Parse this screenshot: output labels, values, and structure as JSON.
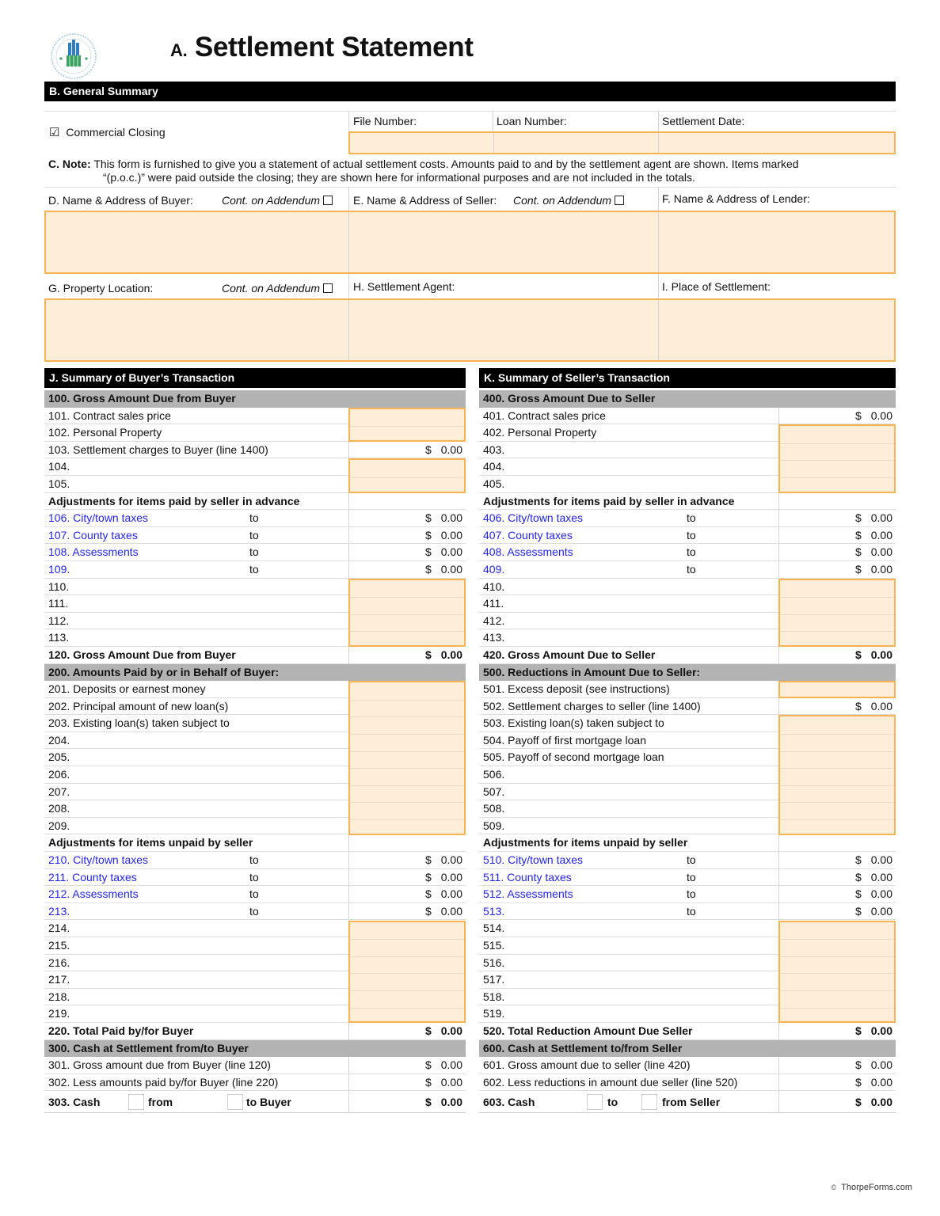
{
  "header": {
    "title_prefix": "A.",
    "title": "Settlement Statement",
    "seal_icon": "hud-seal-icon"
  },
  "general_summary": {
    "bar_label": "B. General Summary",
    "commercial_closing": {
      "label": "Commercial Closing",
      "checked": true,
      "glyph": "☑"
    },
    "file_number": {
      "label": "File Number:",
      "value": ""
    },
    "loan_number": {
      "label": "Loan Number:",
      "value": ""
    },
    "settlement_date": {
      "label": "Settlement Date:",
      "value": ""
    },
    "note_label": "C. Note:",
    "note_line1": "This form is furnished to give you a statement of actual settlement costs. Amounts paid to and by the settlement agent are shown. Items marked",
    "note_line2": "“(p.o.c.)” were paid outside the closing; they are shown here for informational purposes and are not included in the totals.",
    "buyer": {
      "label": "D. Name & Address of Buyer:",
      "addendum": "Cont. on Addendum",
      "value": ""
    },
    "seller": {
      "label": "E. Name & Address of Seller:",
      "addendum": "Cont. on Addendum",
      "value": ""
    },
    "lender": {
      "label": "F. Name & Address of Lender:",
      "value": ""
    },
    "property": {
      "label": "G. Property Location:",
      "addendum": "Cont. on Addendum",
      "value": ""
    },
    "agent": {
      "label": "H. Settlement Agent:",
      "value": ""
    },
    "place": {
      "label": "I. Place of Settlement:",
      "value": ""
    }
  },
  "buyer_summary": {
    "bar_label": "J. Summary of Buyer’s Transaction",
    "rows": [
      {
        "type": "gray",
        "text": "100. Gross Amount Due from Buyer"
      },
      {
        "type": "input",
        "text": "101. Contract sales price"
      },
      {
        "type": "input",
        "text": "102. Personal Property"
      },
      {
        "type": "calc",
        "text": "103. Settlement charges to Buyer (line 1400)",
        "amount": "0.00"
      },
      {
        "type": "input",
        "text": "104."
      },
      {
        "type": "input",
        "text": "105."
      },
      {
        "type": "bold",
        "text": "Adjustments for items paid by seller in advance"
      },
      {
        "type": "blue",
        "text": "106. City/town taxes",
        "to": "to",
        "amount": "0.00"
      },
      {
        "type": "blue",
        "text": "107. County taxes",
        "to": "to",
        "amount": "0.00"
      },
      {
        "type": "blue",
        "text": "108. Assessments",
        "to": "to",
        "amount": "0.00"
      },
      {
        "type": "blue",
        "text": "109.",
        "to": "to",
        "amount": "0.00"
      },
      {
        "type": "input",
        "text": "110."
      },
      {
        "type": "input",
        "text": "111."
      },
      {
        "type": "input",
        "text": "112."
      },
      {
        "type": "input",
        "text": "113."
      },
      {
        "type": "boldcalc",
        "text": "120. Gross Amount Due from Buyer",
        "amount": "0.00"
      },
      {
        "type": "gray",
        "text": "200. Amounts Paid by or in Behalf of Buyer:"
      },
      {
        "type": "input",
        "text": "201. Deposits or earnest money"
      },
      {
        "type": "input",
        "text": "202. Principal amount of new loan(s)"
      },
      {
        "type": "input",
        "text": "203. Existing loan(s) taken subject to"
      },
      {
        "type": "input",
        "text": "204."
      },
      {
        "type": "input",
        "text": "205."
      },
      {
        "type": "input",
        "text": "206."
      },
      {
        "type": "input",
        "text": "207."
      },
      {
        "type": "input",
        "text": "208."
      },
      {
        "type": "input",
        "text": "209."
      },
      {
        "type": "bold",
        "text": "Adjustments for items unpaid by seller"
      },
      {
        "type": "blue",
        "text": "210. City/town taxes",
        "to": "to",
        "amount": "0.00"
      },
      {
        "type": "blue",
        "text": "211. County taxes",
        "to": "to",
        "amount": "0.00"
      },
      {
        "type": "blue",
        "text": "212. Assessments",
        "to": "to",
        "amount": "0.00"
      },
      {
        "type": "blue",
        "text": "213.",
        "to": "to",
        "amount": "0.00"
      },
      {
        "type": "input",
        "text": "214."
      },
      {
        "type": "input",
        "text": "215."
      },
      {
        "type": "input",
        "text": "216."
      },
      {
        "type": "input",
        "text": "217."
      },
      {
        "type": "input",
        "text": "218."
      },
      {
        "type": "input",
        "text": "219."
      },
      {
        "type": "boldcalc",
        "text": "220. Total Paid by/for Buyer",
        "amount": "0.00"
      },
      {
        "type": "gray",
        "text": "300. Cash at Settlement from/to Buyer"
      },
      {
        "type": "calc",
        "text": "301. Gross amount due from Buyer (line 120)",
        "amount": "0.00"
      },
      {
        "type": "calc",
        "text": "302. Less amounts paid by/for Buyer (line 220)",
        "amount": "0.00"
      }
    ],
    "cash": {
      "text": "303. Cash",
      "opt1": "from",
      "opt2": "to Buyer",
      "amount": "0.00"
    }
  },
  "seller_summary": {
    "bar_label": "K. Summary of Seller’s Transaction",
    "rows": [
      {
        "type": "gray",
        "text": "400. Gross Amount Due to Seller"
      },
      {
        "type": "calc",
        "text": "401. Contract sales price",
        "amount": "0.00"
      },
      {
        "type": "input",
        "text": "402. Personal Property"
      },
      {
        "type": "input",
        "text": "403."
      },
      {
        "type": "input",
        "text": "404."
      },
      {
        "type": "input",
        "text": "405."
      },
      {
        "type": "bold",
        "text": "Adjustments for items paid by seller in advance"
      },
      {
        "type": "blue",
        "text": "406. City/town taxes",
        "to": "to",
        "amount": "0.00"
      },
      {
        "type": "blue",
        "text": "407. County taxes",
        "to": "to",
        "amount": "0.00"
      },
      {
        "type": "blue",
        "text": "408. Assessments",
        "to": "to",
        "amount": "0.00"
      },
      {
        "type": "blue",
        "text": "409.",
        "to": "to",
        "amount": "0.00"
      },
      {
        "type": "input",
        "text": "410."
      },
      {
        "type": "input",
        "text": "411."
      },
      {
        "type": "input",
        "text": "412."
      },
      {
        "type": "input",
        "text": "413."
      },
      {
        "type": "boldcalc",
        "text": "420. Gross Amount Due to Seller",
        "amount": "0.00"
      },
      {
        "type": "gray",
        "text": "500. Reductions in Amount Due to Seller:"
      },
      {
        "type": "input",
        "text": "501. Excess deposit (see instructions)"
      },
      {
        "type": "calc",
        "text": "502. Settlement charges to seller (line 1400)",
        "amount": "0.00"
      },
      {
        "type": "input",
        "text": "503. Existing loan(s) taken subject to"
      },
      {
        "type": "input",
        "text": "504. Payoff of first mortgage loan"
      },
      {
        "type": "input",
        "text": "505. Payoff of second mortgage loan"
      },
      {
        "type": "input",
        "text": "506."
      },
      {
        "type": "input",
        "text": "507."
      },
      {
        "type": "input",
        "text": "508."
      },
      {
        "type": "input",
        "text": "509."
      },
      {
        "type": "bold",
        "text": "Adjustments for items unpaid by seller"
      },
      {
        "type": "blue",
        "text": "510. City/town taxes",
        "to": "to",
        "amount": "0.00"
      },
      {
        "type": "blue",
        "text": "511. County taxes",
        "to": "to",
        "amount": "0.00"
      },
      {
        "type": "blue",
        "text": "512. Assessments",
        "to": "to",
        "amount": "0.00"
      },
      {
        "type": "blue",
        "text": "513.",
        "to": "to",
        "amount": "0.00"
      },
      {
        "type": "input",
        "text": "514."
      },
      {
        "type": "input",
        "text": "515."
      },
      {
        "type": "input",
        "text": "516."
      },
      {
        "type": "input",
        "text": "517."
      },
      {
        "type": "input",
        "text": "518."
      },
      {
        "type": "input",
        "text": "519."
      },
      {
        "type": "boldcalc",
        "text": "520. Total Reduction Amount Due Seller",
        "amount": "0.00"
      },
      {
        "type": "gray",
        "text": "600. Cash at Settlement to/from Seller"
      },
      {
        "type": "calc",
        "text": "601. Gross amount due to seller (line 420)",
        "amount": "0.00"
      },
      {
        "type": "calc",
        "text": "602. Less reductions in amount due seller (line 520)",
        "amount": "0.00"
      }
    ],
    "cash": {
      "text": "603. Cash",
      "opt1": "to",
      "opt2": "from Seller",
      "amount": "0.00"
    }
  },
  "currency_symbol": "$",
  "colors": {
    "field_fill": "#fdedd9",
    "field_border": "#f9b350",
    "link_blue": "#2323ef",
    "section_gray": "#b3b3b3"
  },
  "footer": {
    "copyright_glyph": "©",
    "text": "ThorpeForms.com"
  }
}
